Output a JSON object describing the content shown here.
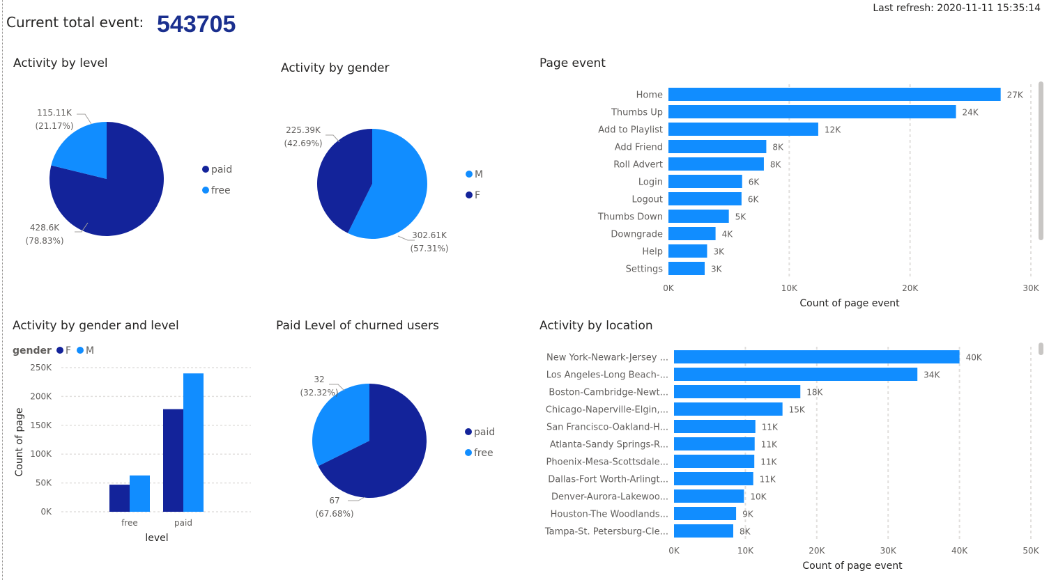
{
  "header": {
    "kpi_label": "Current total event:",
    "kpi_value": "543705",
    "last_refresh": "Last refresh: 2020-11-11 15:35:14"
  },
  "colors": {
    "dark": "#13239a",
    "light": "#118dff",
    "kpi": "#1a2f8e"
  },
  "chart_data": [
    {
      "id": "level",
      "type": "pie",
      "title": "Activity by level",
      "slices": [
        {
          "label": "paid",
          "value": 428.6,
          "display": "428.6K",
          "pct": "(78.83%)",
          "color": "#13239a"
        },
        {
          "label": "free",
          "value": 115.11,
          "display": "115.11K",
          "pct": "(21.17%)",
          "color": "#118dff"
        }
      ],
      "legend": [
        "paid",
        "free"
      ]
    },
    {
      "id": "gender",
      "type": "pie",
      "title": "Activity by gender",
      "slices": [
        {
          "label": "M",
          "value": 302.61,
          "display": "302.61K",
          "pct": "(57.31%)",
          "color": "#118dff"
        },
        {
          "label": "F",
          "value": 225.39,
          "display": "225.39K",
          "pct": "(42.69%)",
          "color": "#13239a"
        }
      ],
      "legend": [
        "M",
        "F"
      ]
    },
    {
      "id": "page",
      "type": "bar",
      "orientation": "horizontal",
      "title": "Page event",
      "xlabel": "Count of page event",
      "categories": [
        "Home",
        "Thumbs Up",
        "Add to Playlist",
        "Add Friend",
        "Roll Advert",
        "Login",
        "Logout",
        "Thumbs Down",
        "Downgrade",
        "Help",
        "Settings"
      ],
      "values": [
        27500,
        23800,
        12400,
        8100,
        7900,
        6100,
        6050,
        5000,
        3900,
        3200,
        3000
      ],
      "data_labels": [
        "27K",
        "24K",
        "12K",
        "8K",
        "8K",
        "6K",
        "6K",
        "5K",
        "4K",
        "3K",
        "3K"
      ],
      "xlim": [
        0,
        30000
      ],
      "ticks": [
        "0K",
        "10K",
        "20K",
        "30K"
      ],
      "color": "#118dff"
    },
    {
      "id": "gender_level",
      "type": "bar",
      "title": "Activity by gender and level",
      "legend_title": "gender",
      "xlabel": "level",
      "ylabel": "Count of page",
      "categories": [
        "free",
        "paid"
      ],
      "series": [
        {
          "name": "F",
          "values": [
            47000,
            178000
          ],
          "color": "#13239a"
        },
        {
          "name": "M",
          "values": [
            63000,
            240000
          ],
          "color": "#118dff"
        }
      ],
      "ylim": [
        0,
        250000
      ],
      "ticks": [
        "0K",
        "50K",
        "100K",
        "150K",
        "200K",
        "250K"
      ]
    },
    {
      "id": "churned",
      "type": "pie",
      "title": "Paid Level of churned users",
      "slices": [
        {
          "label": "paid",
          "value": 67,
          "display": "67",
          "pct": "(67.68%)",
          "color": "#13239a"
        },
        {
          "label": "free",
          "value": 32,
          "display": "32",
          "pct": "(32.32%)",
          "color": "#118dff"
        }
      ],
      "legend": [
        "paid",
        "free"
      ]
    },
    {
      "id": "location",
      "type": "bar",
      "orientation": "horizontal",
      "title": "Activity by location",
      "xlabel": "Count of page event",
      "categories": [
        "New York-Newark-Jersey ...",
        "Los Angeles-Long Beach-...",
        "Boston-Cambridge-Newt...",
        "Chicago-Naperville-Elgin,...",
        "San Francisco-Oakland-H...",
        "Atlanta-Sandy Springs-R...",
        "Phoenix-Mesa-Scottsdale...",
        "Dallas-Fort Worth-Arlingt...",
        "Denver-Aurora-Lakewoo...",
        "Houston-The Woodlands...",
        "Tampa-St. Petersburg-Cle..."
      ],
      "values": [
        40000,
        34100,
        17700,
        15200,
        11400,
        11300,
        11250,
        11100,
        9800,
        8700,
        8300
      ],
      "data_labels": [
        "40K",
        "34K",
        "18K",
        "15K",
        "11K",
        "11K",
        "11K",
        "11K",
        "10K",
        "9K",
        "8K"
      ],
      "xlim": [
        0,
        50000
      ],
      "ticks": [
        "0K",
        "10K",
        "20K",
        "30K",
        "40K",
        "50K"
      ],
      "color": "#118dff"
    }
  ]
}
